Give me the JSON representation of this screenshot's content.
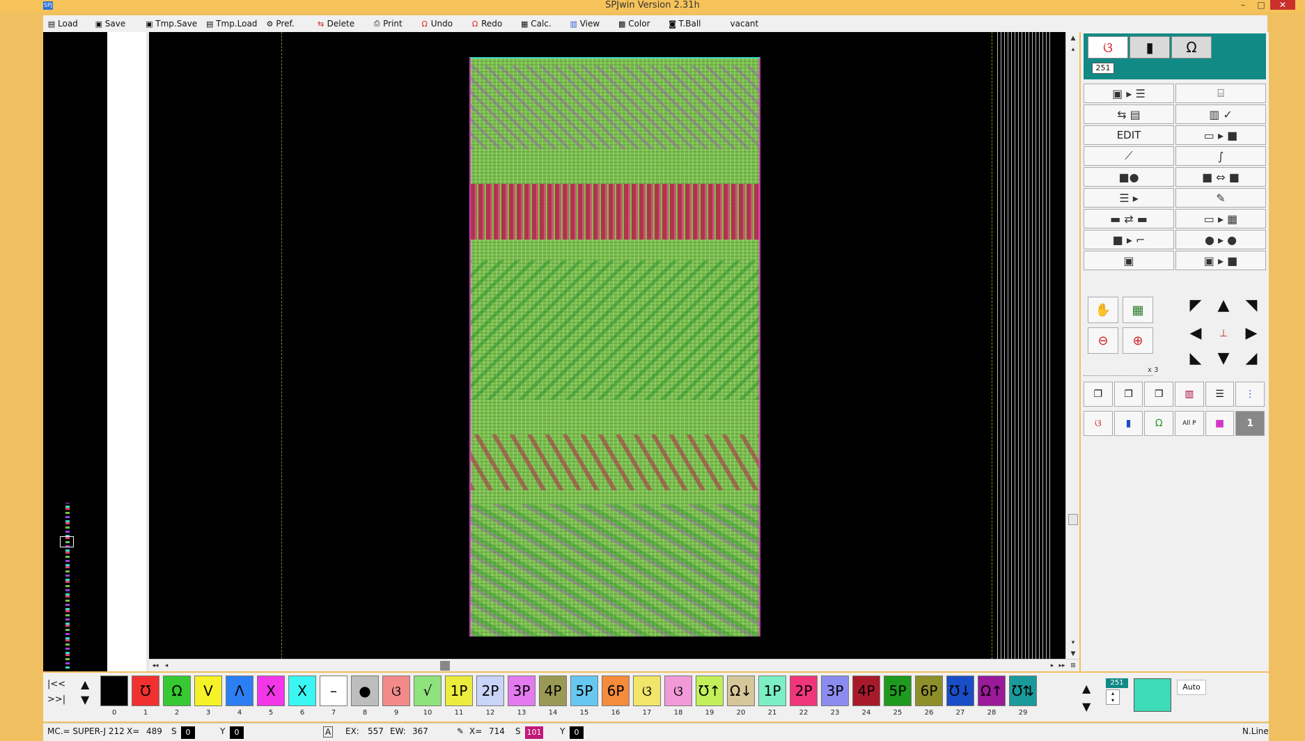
{
  "window": {
    "title": "SPJwin Version 2.31h",
    "app_icon": "SPJ",
    "minimize": "–",
    "maximize": "□",
    "close": "✕"
  },
  "menu": [
    {
      "label": "Load",
      "icon": "doc-icon"
    },
    {
      "label": "Save",
      "icon": "save-icon"
    },
    {
      "label": "Tmp.Save",
      "icon": "tmp-save-icon"
    },
    {
      "label": "Tmp.Load",
      "icon": "tmp-load-icon"
    },
    {
      "label": "Pref.",
      "icon": "pref-icon"
    },
    {
      "label": "Delete",
      "icon": "delete-icon"
    },
    {
      "label": "Print",
      "icon": "print-icon"
    },
    {
      "label": "Undo",
      "icon": "undo-icon"
    },
    {
      "label": "Redo",
      "icon": "redo-icon"
    },
    {
      "label": "Calc.",
      "icon": "calc-icon"
    },
    {
      "label": "View",
      "icon": "view-icon"
    },
    {
      "label": "Color",
      "icon": "color-icon"
    },
    {
      "label": "T.Ball",
      "icon": "tball-icon"
    },
    {
      "label": "vacant",
      "icon": ""
    }
  ],
  "colors": {
    "knit_green": "#79c14a",
    "band_red": "#b3264a",
    "accent_teal": "#118a86",
    "preview": "#3ddcb8"
  },
  "right_panel": {
    "mode_number": "251",
    "edit_label": "EDIT",
    "zoom_label": "x 3",
    "allp_label": "All P",
    "one_label": "1"
  },
  "palette": {
    "nav_first": "|<<",
    "nav_last": ">>|",
    "items": [
      {
        "num": "0",
        "glyph": "",
        "color": "#000000"
      },
      {
        "num": "1",
        "glyph": "Ʊ",
        "color": "#f1312f"
      },
      {
        "num": "2",
        "glyph": "Ω",
        "color": "#36c933"
      },
      {
        "num": "3",
        "glyph": "V",
        "color": "#f5f227"
      },
      {
        "num": "4",
        "glyph": "Λ",
        "color": "#2b7ff3"
      },
      {
        "num": "5",
        "glyph": "X",
        "color": "#f236e8"
      },
      {
        "num": "6",
        "glyph": "X",
        "color": "#3af6f3"
      },
      {
        "num": "7",
        "glyph": "–",
        "color": "#ffffff"
      },
      {
        "num": "8",
        "glyph": "●",
        "color": "#bdbdbd"
      },
      {
        "num": "9",
        "glyph": "ଓ",
        "color": "#f28a8a"
      },
      {
        "num": "10",
        "glyph": "√",
        "color": "#8fe37d"
      },
      {
        "num": "11",
        "glyph": "1P",
        "color": "#ecec3f"
      },
      {
        "num": "12",
        "glyph": "2P",
        "color": "#c8d4f8"
      },
      {
        "num": "13",
        "glyph": "3P",
        "color": "#e47af0"
      },
      {
        "num": "14",
        "glyph": "4P",
        "color": "#9a9a55"
      },
      {
        "num": "15",
        "glyph": "5P",
        "color": "#66c8f0"
      },
      {
        "num": "16",
        "glyph": "6P",
        "color": "#f58c3c"
      },
      {
        "num": "17",
        "glyph": "ଓ",
        "color": "#f1e66a"
      },
      {
        "num": "18",
        "glyph": "ଓ",
        "color": "#f29ad8"
      },
      {
        "num": "19",
        "glyph": "Ʊ↑",
        "color": "#c2f05a"
      },
      {
        "num": "20",
        "glyph": "Ω↓",
        "color": "#d6c79a"
      },
      {
        "num": "21",
        "glyph": "1P",
        "color": "#7cf0c4"
      },
      {
        "num": "22",
        "glyph": "2P",
        "color": "#f0367a"
      },
      {
        "num": "23",
        "glyph": "3P",
        "color": "#8c8cf0"
      },
      {
        "num": "24",
        "glyph": "4P",
        "color": "#a81a2a"
      },
      {
        "num": "25",
        "glyph": "5P",
        "color": "#1e9a1e"
      },
      {
        "num": "26",
        "glyph": "6P",
        "color": "#8f8f2a"
      },
      {
        "num": "27",
        "glyph": "Ʊ↓",
        "color": "#1a4ec8"
      },
      {
        "num": "28",
        "glyph": "Ω↑",
        "color": "#9a1a9a"
      },
      {
        "num": "29",
        "glyph": "Ʊ⇅",
        "color": "#1a9a9a"
      }
    ],
    "color_num": "251",
    "auto_label": "Auto"
  },
  "status": {
    "mc": "MC.= SUPER-J 212",
    "x_label": "X=",
    "x_value": "489",
    "s_label": "S",
    "s_box": "0",
    "y_label": "Y",
    "y_box": "0",
    "a_label": "A",
    "ex_label": "EX:",
    "ex_value": "557",
    "ew_label": "EW:",
    "ew_value": "367",
    "x2_label": "X=",
    "x2_value": "714",
    "s2_label": "S",
    "s2_box": "101",
    "y2_label": "Y",
    "y2_box": "0",
    "right_text": "N.Line"
  }
}
